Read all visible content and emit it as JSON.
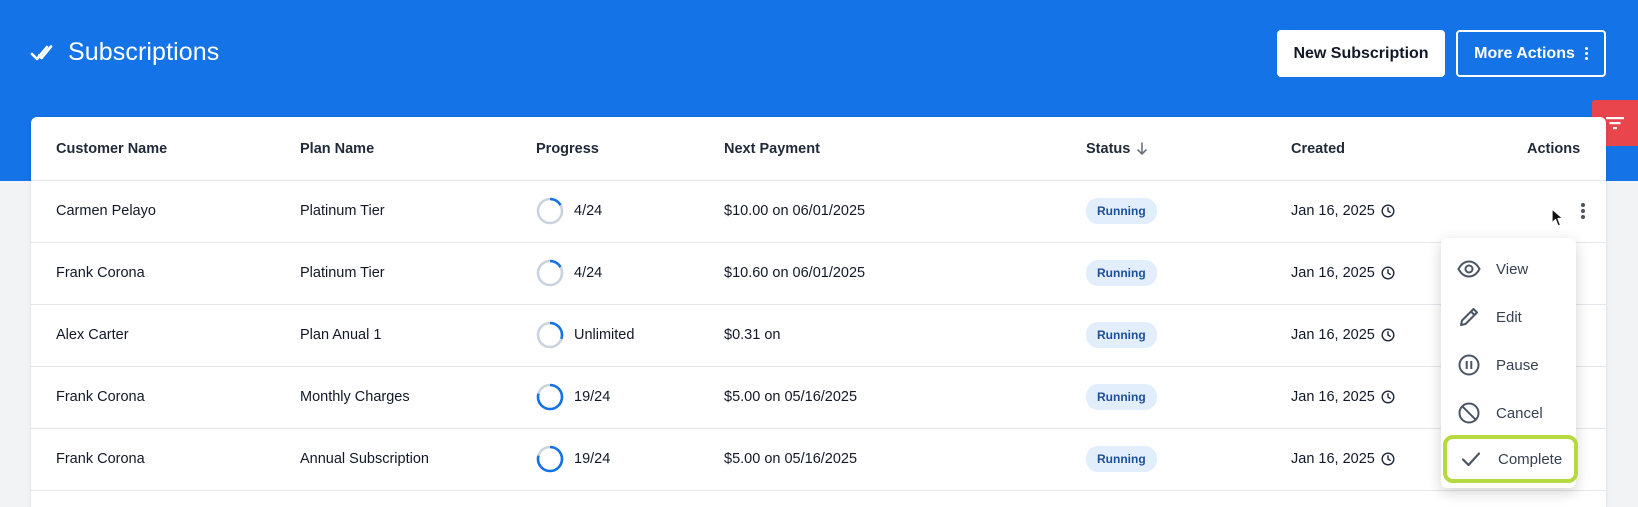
{
  "header": {
    "title": "Subscriptions",
    "title_icon": "double-check-icon",
    "new_button": "New Subscription",
    "more_button": "More Actions"
  },
  "table": {
    "columns": {
      "customer": "Customer Name",
      "plan": "Plan Name",
      "progress": "Progress",
      "next_payment": "Next Payment",
      "status": "Status",
      "created": "Created",
      "actions": "Actions"
    },
    "rows": [
      {
        "customer": "Carmen Pelayo",
        "plan": "Platinum Tier",
        "progress": "4/24",
        "progress_fraction": 0.167,
        "next_payment": "$10.00 on 06/01/2025",
        "status": "Running",
        "created": "Jan 16, 2025"
      },
      {
        "customer": "Frank Corona",
        "plan": "Platinum Tier",
        "progress": "4/24",
        "progress_fraction": 0.167,
        "next_payment": "$10.60 on 06/01/2025",
        "status": "Running",
        "created": "Jan 16, 2025"
      },
      {
        "customer": "Alex Carter",
        "plan": "Plan Anual 1",
        "progress": "Unlimited",
        "progress_fraction": 0.3,
        "next_payment": "$0.31 on",
        "status": "Running",
        "created": "Jan 16, 2025"
      },
      {
        "customer": "Frank Corona",
        "plan": "Monthly Charges",
        "progress": "19/24",
        "progress_fraction": 0.79,
        "next_payment": "$5.00 on 05/16/2025",
        "status": "Running",
        "created": "Jan 16, 2025"
      },
      {
        "customer": "Frank Corona",
        "plan": "Annual Subscription",
        "progress": "19/24",
        "progress_fraction": 0.79,
        "next_payment": "$5.00 on 05/16/2025",
        "status": "Running",
        "created": "Jan 16, 2025"
      }
    ]
  },
  "menu": {
    "view": "View",
    "edit": "Edit",
    "pause": "Pause",
    "cancel": "Cancel",
    "complete": "Complete"
  },
  "colors": {
    "header_bg": "#1473e6",
    "filter_tab": "#e8464c",
    "badge_bg": "#e3eefc",
    "badge_text": "#1d4f9c",
    "highlight": "#b5d93e"
  }
}
